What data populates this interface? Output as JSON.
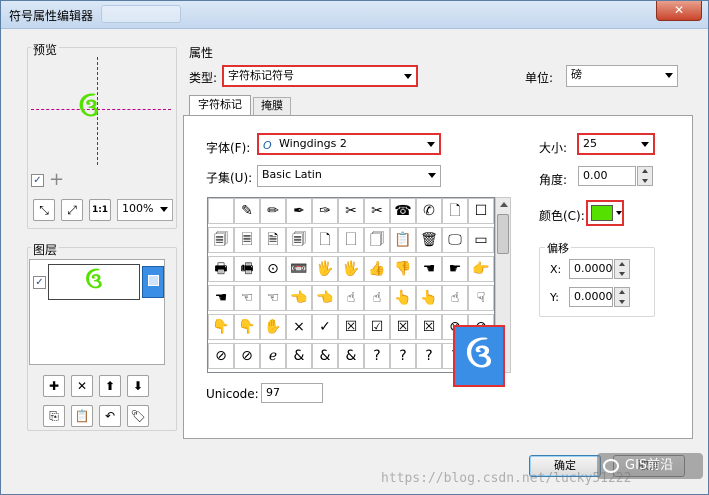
{
  "window": {
    "title": "符号属性编辑器",
    "close_label": "✕"
  },
  "preview": {
    "label": "预览",
    "glyph": "ઉ",
    "glyph_color": "#55e000",
    "checked": "✓",
    "plus": "+",
    "zoom_value": "100%"
  },
  "layers": {
    "label": "图层",
    "checked": "✓",
    "glyph": "ઉ"
  },
  "properties": {
    "label": "属性",
    "type_label": "类型:",
    "type_value": "字符标记符号",
    "unit_label": "单位:",
    "unit_value": "磅",
    "tabs": [
      {
        "label": "字符标记"
      },
      {
        "label": "掩膜"
      }
    ],
    "font_label": "字体(F):",
    "font_value": "Wingdings 2",
    "font_icon": "O",
    "subset_label": "子集(U):",
    "subset_value": "Basic Latin",
    "size_label": "大小:",
    "size_value": "25",
    "angle_label": "角度:",
    "angle_value": "0.00",
    "color_label": "颜色(C):",
    "color_value": "#55e000",
    "offset_label": "偏移",
    "x_label": "X:",
    "x_value": "0.0000",
    "y_label": "Y:",
    "y_value": "0.0000",
    "unicode_label": "Unicode:",
    "unicode_value": "97",
    "selected_glyph": "ઉ"
  },
  "glyphs": [
    [
      "",
      "✎",
      "✏",
      "✒",
      "✑",
      "✂",
      "✂",
      "☎",
      "✆",
      "🗋",
      "☐"
    ],
    [
      "🗐",
      "🗏",
      "🗎",
      "🗐",
      "🗋",
      "🗌",
      "🗍",
      "📋",
      "🗑",
      "🖵",
      "▭"
    ],
    [
      "🖶",
      "🖷",
      "⊙",
      "📼",
      "🖐",
      "🖐",
      "👍",
      "👎",
      "☚",
      "☛",
      "👉"
    ],
    [
      "☚",
      "☜",
      "☜",
      "👈",
      "👈",
      "☝",
      "☝",
      "👆",
      "👆",
      "☝",
      "☟"
    ],
    [
      "👇",
      "👇",
      "✋",
      "×",
      "✓",
      "☒",
      "☑",
      "☒",
      "☒",
      "⊗",
      "⊘"
    ],
    [
      "⊘",
      "⊘",
      "ℯ",
      "&",
      "&",
      "&",
      "?",
      "?",
      "?",
      "?",
      "?"
    ]
  ],
  "buttons": {
    "ok_label": "确定",
    "cancel_label": "取消"
  },
  "watermark": {
    "url": "https://blog.csdn.net/lucky51222",
    "brand": "GIS前沿"
  }
}
